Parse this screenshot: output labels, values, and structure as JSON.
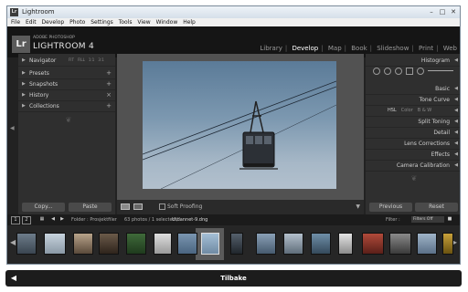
{
  "window": {
    "title": "Lightroom",
    "controls": [
      "–",
      "□",
      "✕"
    ]
  },
  "menu": [
    "File",
    "Edit",
    "Develop",
    "Photo",
    "Settings",
    "Tools",
    "View",
    "Window",
    "Help"
  ],
  "identity": {
    "logo": "Lr",
    "brand_small": "ADOBE PHOTOSHOP",
    "brand_big": "LIGHTROOM 4"
  },
  "modules": [
    {
      "label": "Library",
      "active": false
    },
    {
      "label": "Develop",
      "active": true
    },
    {
      "label": "Map",
      "active": false
    },
    {
      "label": "Book",
      "active": false
    },
    {
      "label": "Slideshow",
      "active": false
    },
    {
      "label": "Print",
      "active": false
    },
    {
      "label": "Web",
      "active": false
    }
  ],
  "left_panel": {
    "navigator": "Navigator",
    "navigator_zoom": [
      "FIT",
      "FILL",
      "1:1",
      "3:1"
    ],
    "sections": [
      "Presets",
      "Snapshots",
      "History",
      "Collections"
    ],
    "copy_button": "Copy...",
    "paste_button": "Paste"
  },
  "toolbar": {
    "soft_proofing": "Soft Proofing"
  },
  "right_panel": {
    "histogram": "Histogram",
    "sections": [
      "Basic",
      "Tone Curve",
      "HSL / Color / B & W",
      "Split Toning",
      "Detail",
      "Lens Corrections",
      "Effects",
      "Camera Calibration"
    ],
    "hsl_tabs": [
      "HSL",
      "Color",
      "B & W"
    ],
    "previous_button": "Previous",
    "reset_button": "Reset"
  },
  "filmstrip_bar": {
    "page1": "1",
    "page2": "2",
    "source": "Folder : Prosjektfiler",
    "count": "63 photos / 1 selected /",
    "filename": "Utdannet-9.dng",
    "filter_label": "Filter :",
    "filter_value": "Filters Off"
  },
  "bottom_bar": {
    "back_label": "Tilbake"
  },
  "colors": {
    "panel_bg": "#2f2f2f",
    "app_bg": "#222222",
    "active_module": "#ffffff"
  }
}
